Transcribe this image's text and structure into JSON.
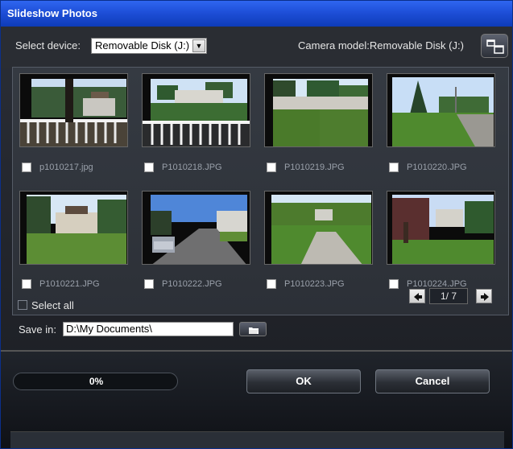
{
  "window": {
    "title": "Slideshow Photos"
  },
  "device": {
    "label": "Select device:",
    "value": "Removable Disk (J:)"
  },
  "camera": {
    "label": "Camera model:Removable Disk (J:)"
  },
  "photos": [
    {
      "name": "p1010217.jpg",
      "checked": false
    },
    {
      "name": "P1010218.JPG",
      "checked": false
    },
    {
      "name": "P1010219.JPG",
      "checked": false
    },
    {
      "name": "P1010220.JPG",
      "checked": false
    },
    {
      "name": "P1010221.JPG",
      "checked": false
    },
    {
      "name": "P1010222.JPG",
      "checked": false
    },
    {
      "name": "P1010223.JPG",
      "checked": false
    },
    {
      "name": "P1010224.JPG",
      "checked": false
    }
  ],
  "select_all": {
    "label": "Select all",
    "checked": false
  },
  "pagination": {
    "text": "1/ 7"
  },
  "save": {
    "label": "Save in:",
    "value": "D:\\My Documents\\"
  },
  "progress": {
    "value": 0,
    "text": "0%"
  },
  "buttons": {
    "ok": "OK",
    "cancel": "Cancel"
  },
  "colors": {
    "title_blue": "#1e4fd8",
    "panel": "#2c3037",
    "progress_fill": "#2f6ad8"
  }
}
